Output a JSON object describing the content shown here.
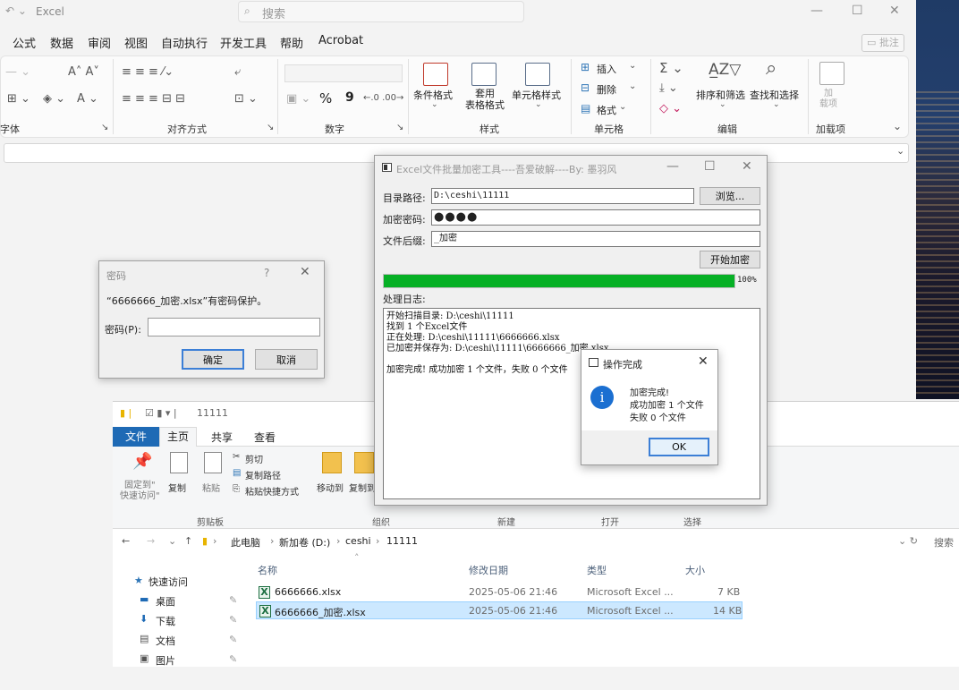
{
  "excel": {
    "app_name": "Excel",
    "search_placeholder": "搜索",
    "menu": [
      "公式",
      "数据",
      "审阅",
      "视图",
      "自动执行",
      "开发工具",
      "帮助",
      "Acrobat"
    ],
    "comments_button": "批注",
    "ribbon": {
      "groups": [
        "字体",
        "对齐方式",
        "数字",
        "样式",
        "单元格",
        "编辑",
        "加载项"
      ],
      "percent_symbol": "%",
      "comma_symbol": "9",
      "styles_buttons": [
        "条件格式",
        "套用\n表格格式",
        "单元格样式"
      ],
      "cells_buttons": [
        "插入",
        "删除",
        "格式"
      ],
      "editing_buttons": [
        "排序和筛选",
        "查找和选择"
      ],
      "addins_button": "加\n载项"
    }
  },
  "password_dialog": {
    "title": "密码",
    "help": "?",
    "message": "“6666666_加密.xlsx”有密码保护。",
    "label": "密码(P):",
    "ok": "确定",
    "cancel": "取消"
  },
  "tool": {
    "title": "Excel文件批量加密工具----吾爱破解----By: 墨羽风",
    "dir_label": "目录路径:",
    "dir_value": "D:\\ceshi\\11111",
    "browse": "浏览...",
    "pwd_label": "加密密码:",
    "pwd_value": "●●●●",
    "suffix_label": "文件后缀:",
    "suffix_value": "_加密",
    "start": "开始加密",
    "progress": 100,
    "progress_text": "100%",
    "log_label": "处理日志:",
    "log_lines": [
      "开始扫描目录: D:\\ceshi\\11111",
      "找到 1 个Excel文件",
      "正在处理: D:\\ceshi\\11111\\6666666.xlsx",
      "已加密并保存为: D:\\ceshi\\11111\\6666666_加密.xlsx",
      "",
      "加密完成! 成功加密 1 个文件，失败 0 个文件"
    ]
  },
  "done_dialog": {
    "title": "操作完成",
    "lines": [
      "加密完成!",
      "成功加密 1 个文件",
      "失败 0 个文件"
    ],
    "ok": "OK"
  },
  "explorer": {
    "title": "11111",
    "tabs": [
      "文件",
      "主页",
      "共享",
      "查看"
    ],
    "ribbon": {
      "pin": "固定到\"\n快速访问\"",
      "copy": "复制",
      "paste": "粘贴",
      "cut": "剪切",
      "copy_path": "复制路径",
      "paste_shortcut": "粘贴快捷方式",
      "move_to": "移动到",
      "copy_to": "复制到",
      "groups": [
        "剪贴板",
        "组织",
        "新建",
        "打开",
        "选择"
      ]
    },
    "breadcrumb": [
      "此电脑",
      "新加卷 (D:)",
      "ceshi",
      "11111"
    ],
    "search": "搜索",
    "nav": [
      "快速访问",
      "桌面",
      "下载",
      "文档",
      "图片"
    ],
    "columns": [
      "名称",
      "修改日期",
      "类型",
      "大小"
    ],
    "files": [
      {
        "name": "6666666.xlsx",
        "date": "2025-05-06 21:46",
        "type": "Microsoft Excel ...",
        "size": "7 KB"
      },
      {
        "name": "6666666_加密.xlsx",
        "date": "2025-05-06 21:46",
        "type": "Microsoft Excel ...",
        "size": "14 KB"
      }
    ]
  }
}
